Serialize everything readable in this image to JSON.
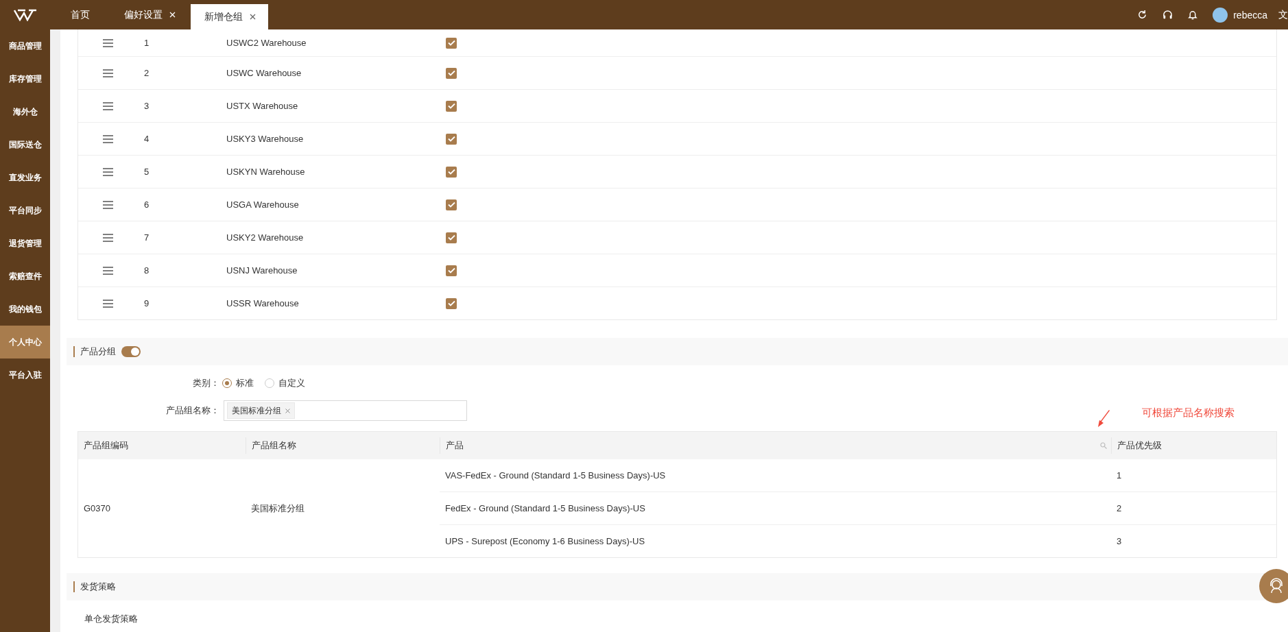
{
  "tabs": [
    {
      "label": "首页",
      "closable": false,
      "selected": false
    },
    {
      "label": "偏好设置",
      "closable": true,
      "selected": false
    },
    {
      "label": "新增仓组",
      "closable": true,
      "selected": true
    }
  ],
  "header": {
    "user": "rebecca",
    "language": "文"
  },
  "sidebar": {
    "items": [
      {
        "label": "商品管理",
        "selected": false
      },
      {
        "label": "库存管理",
        "selected": false
      },
      {
        "label": "海外仓",
        "selected": false
      },
      {
        "label": "国际送仓",
        "selected": false
      },
      {
        "label": "直发业务",
        "selected": false
      },
      {
        "label": "平台同步",
        "selected": false
      },
      {
        "label": "退货管理",
        "selected": false
      },
      {
        "label": "索赔查件",
        "selected": false
      },
      {
        "label": "我的钱包",
        "selected": false
      },
      {
        "label": "个人中心",
        "selected": true
      },
      {
        "label": "平台入驻",
        "selected": false
      }
    ]
  },
  "warehouses": [
    {
      "index": "1",
      "name": "USWC2 Warehouse",
      "checked": true
    },
    {
      "index": "2",
      "name": "USWC Warehouse",
      "checked": true
    },
    {
      "index": "3",
      "name": "USTX Warehouse",
      "checked": true
    },
    {
      "index": "4",
      "name": "USKY3 Warehouse",
      "checked": true
    },
    {
      "index": "5",
      "name": "USKYN Warehouse",
      "checked": true
    },
    {
      "index": "6",
      "name": "USGA Warehouse",
      "checked": true
    },
    {
      "index": "7",
      "name": "USKY2 Warehouse",
      "checked": true
    },
    {
      "index": "8",
      "name": "USNJ Warehouse",
      "checked": true
    },
    {
      "index": "9",
      "name": "USSR Warehouse",
      "checked": true
    }
  ],
  "product_group": {
    "title": "产品分组",
    "enabled": true,
    "category_label": "类别：",
    "options": [
      {
        "label": "标准",
        "selected": true
      },
      {
        "label": "自定义",
        "selected": false
      }
    ],
    "name_label": "产品组名称：",
    "tags": [
      "美国标准分组"
    ],
    "table": {
      "columns": [
        "产品组编码",
        "产品组名称",
        "产品",
        "产品优先级"
      ],
      "groups": [
        {
          "code": "G0370",
          "name": "美国标准分组",
          "products": [
            {
              "name": "VAS-FedEx - Ground (Standard 1-5 Business Days)-US",
              "priority": "1"
            },
            {
              "name": "FedEx - Ground (Standard 1-5 Business Days)-US",
              "priority": "2"
            },
            {
              "name": "UPS - Surepost (Economy 1-6 Business Days)-US",
              "priority": "3"
            }
          ]
        }
      ]
    }
  },
  "annotation": "可根据产品名称搜索",
  "shipping": {
    "title": "发货策略",
    "subtitle": "单仓发货策略"
  }
}
